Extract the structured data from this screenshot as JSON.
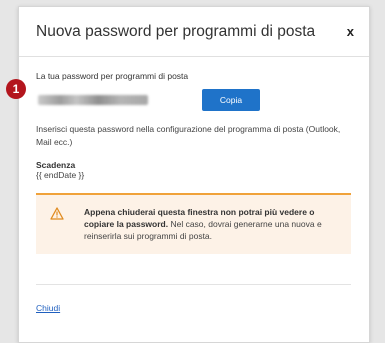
{
  "dialog": {
    "title": "Nuova password per programmi di posta",
    "close_label": "x"
  },
  "marker": "1",
  "password_section": {
    "label": "La tua password per programmi di posta",
    "copy_label": "Copia",
    "hint": "Inserisci questa password nella configurazione del programma di posta (Outlook, Mail ecc.)"
  },
  "expiry": {
    "title": "Scadenza",
    "value": "{{ endDate }}"
  },
  "warning": {
    "bold": "Appena chiuderai questa finestra non potrai più vedere o copiare la password.",
    "rest": " Nel caso, dovrai generarne una nuova e reinserirla sui programmi di posta."
  },
  "footer": {
    "close_link": "Chiudi"
  },
  "colors": {
    "primary": "#1f73c9",
    "warning_bg": "#fdf2e7",
    "warning_border": "#f0a23a",
    "badge": "#b3151d"
  }
}
